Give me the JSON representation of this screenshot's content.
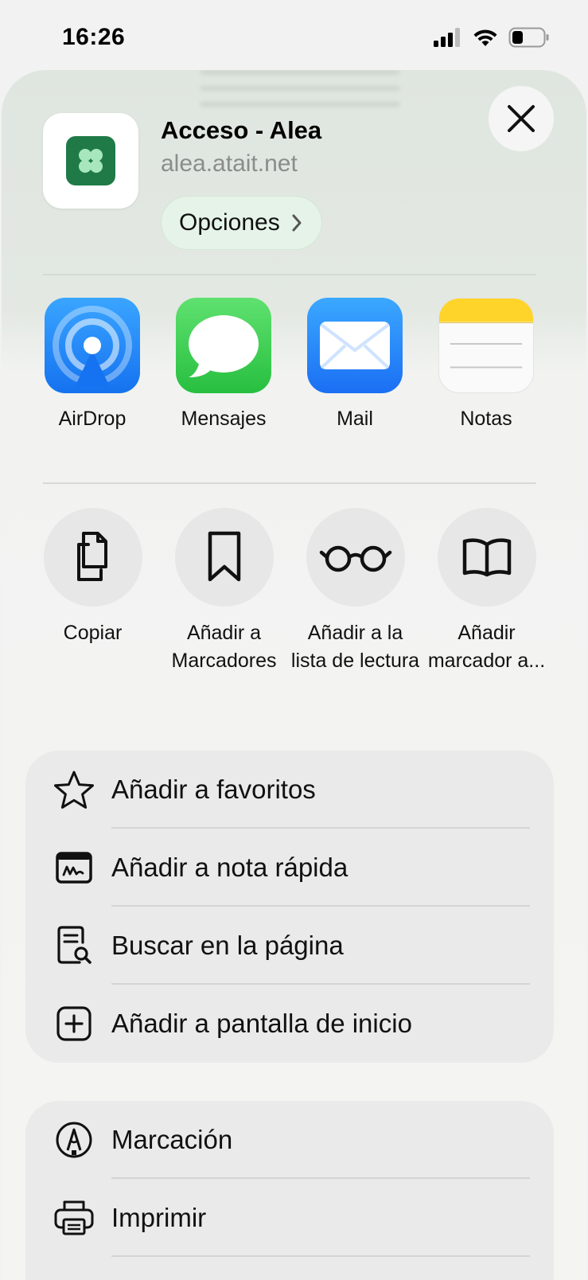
{
  "status_bar": {
    "time": "16:26"
  },
  "header": {
    "title": "Acceso - Alea",
    "url": "alea.atait.net",
    "options_label": "Opciones"
  },
  "share_apps": [
    {
      "label": "AirDrop",
      "icon": "airdrop-icon"
    },
    {
      "label": "Mensajes",
      "icon": "messages-icon"
    },
    {
      "label": "Mail",
      "icon": "mail-icon"
    },
    {
      "label": "Notas",
      "icon": "notes-icon"
    }
  ],
  "actions": [
    {
      "label": "Copiar",
      "icon": "copy-icon"
    },
    {
      "label": "Añadir a Marcadores",
      "icon": "bookmark-icon"
    },
    {
      "label": "Añadir a la lista de lectura",
      "icon": "glasses-icon"
    },
    {
      "label": "Añadir marcador a...",
      "icon": "book-icon"
    }
  ],
  "menu_group_1": [
    {
      "label": "Añadir a favoritos",
      "icon": "star-icon"
    },
    {
      "label": "Añadir a nota rápida",
      "icon": "quick-note-icon"
    },
    {
      "label": "Buscar en la página",
      "icon": "find-in-page-icon"
    },
    {
      "label": "Añadir a pantalla de inicio",
      "icon": "add-square-icon"
    }
  ],
  "menu_group_2": [
    {
      "label": "Marcación",
      "icon": "markup-icon"
    },
    {
      "label": "Imprimir",
      "icon": "printer-icon"
    }
  ],
  "colors": {
    "sheet_top": "#dfe6df",
    "options_bg": "#e6f3e8",
    "app_green": "#1f7a47",
    "menu_bg": "#e9eae9"
  }
}
